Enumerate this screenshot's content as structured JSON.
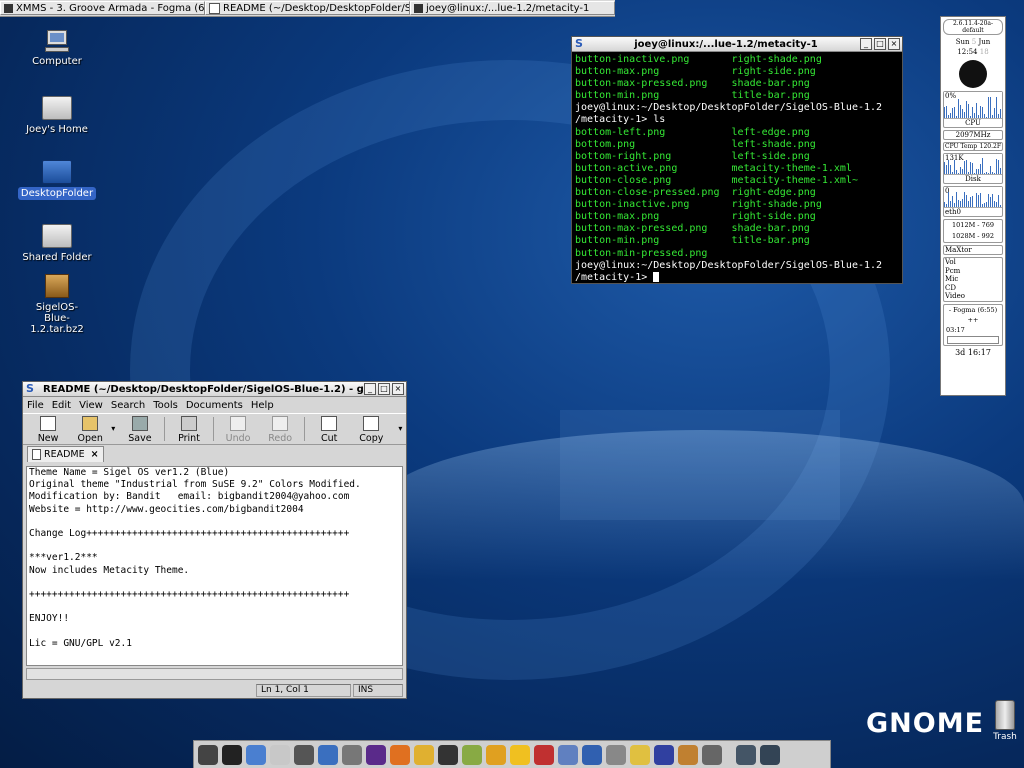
{
  "taskbar": {
    "tasks": [
      {
        "label": "XMMS - 3. Groove Armada - Fogma (6:..."
      },
      {
        "label": "README (~/Desktop/DesktopFolder/Sig..."
      },
      {
        "label": "joey@linux:/...lue-1.2/metacity-1"
      }
    ]
  },
  "desktop": {
    "icons": [
      {
        "label": "Computer",
        "icon": "computer-icon"
      },
      {
        "label": "Joey's Home",
        "icon": "home-folder-icon"
      },
      {
        "label": "DesktopFolder",
        "icon": "folder-icon"
      },
      {
        "label": "Shared Folder",
        "icon": "shared-folder-icon"
      },
      {
        "label": "SigelOS-\nBlue-1.2.tar.bz2",
        "icon": "archive-icon"
      }
    ]
  },
  "terminal": {
    "title": "joey@linux:/...lue-1.2/metacity-1",
    "lines": [
      {
        "text": "button-inactive.png       right-shade.png",
        "color": "green"
      },
      {
        "text": "button-max.png            right-side.png",
        "color": "green"
      },
      {
        "text": "button-max-pressed.png    shade-bar.png",
        "color": "green"
      },
      {
        "text": "button-min.png            title-bar.png",
        "color": "green"
      },
      {
        "text": "joey@linux:~/Desktop/DesktopFolder/SigelOS-Blue-1.2",
        "color": "white"
      },
      {
        "text": "/metacity-1> ls",
        "color": "white"
      },
      {
        "text": "bottom-left.png           left-edge.png",
        "color": "green"
      },
      {
        "text": "bottom.png                left-shade.png",
        "color": "green"
      },
      {
        "text": "bottom-right.png          left-side.png",
        "color": "green"
      },
      {
        "text": "button-active.png         metacity-theme-1.xml",
        "color": "green"
      },
      {
        "text": "button-close.png          metacity-theme-1.xml~",
        "color": "green"
      },
      {
        "text": "button-close-pressed.png  right-edge.png",
        "color": "green"
      },
      {
        "text": "button-inactive.png       right-shade.png",
        "color": "green"
      },
      {
        "text": "button-max.png            right-side.png",
        "color": "green"
      },
      {
        "text": "button-max-pressed.png    shade-bar.png",
        "color": "green"
      },
      {
        "text": "button-min.png            title-bar.png",
        "color": "green"
      },
      {
        "text": "button-min-pressed.png",
        "color": "green"
      },
      {
        "text": "joey@linux:~/Desktop/DesktopFolder/SigelOS-Blue-1.2",
        "color": "white"
      },
      {
        "text": "/metacity-1> ",
        "color": "white"
      }
    ]
  },
  "gedit": {
    "title": "README (~/Desktop/DesktopFolder/SigelOS-Blue-1.2) - gedit",
    "menu": [
      "File",
      "Edit",
      "View",
      "Search",
      "Tools",
      "Documents",
      "Help"
    ],
    "toolbar": [
      {
        "label": "New",
        "icon": "new-document-icon",
        "enabled": true
      },
      {
        "label": "Open",
        "icon": "open-folder-icon",
        "enabled": true
      },
      {
        "label": "Save",
        "icon": "save-disk-icon",
        "enabled": true
      },
      {
        "label": "Print",
        "icon": "printer-icon",
        "enabled": true
      },
      {
        "label": "Undo",
        "icon": "undo-icon",
        "enabled": false
      },
      {
        "label": "Redo",
        "icon": "redo-icon",
        "enabled": false
      },
      {
        "label": "Cut",
        "icon": "scissors-icon",
        "enabled": true
      },
      {
        "label": "Copy",
        "icon": "copy-icon",
        "enabled": true
      }
    ],
    "tab": "README",
    "content": "Theme Name = Sigel OS ver1.2 (Blue)\nOriginal theme \"Industrial from SuSE 9.2\" Colors Modified.\nModification by: Bandit   email: bigbandit2004@yahoo.com\nWebsite = http://www.geocities.com/bigbandit2004\n\nChange Log++++++++++++++++++++++++++++++++++++++++++++++\n\n***ver1.2***\nNow includes Metacity Theme.\n\n++++++++++++++++++++++++++++++++++++++++++++++++++++++++\n\nENJOY!!\n\nLic = GNU/GPL v2.1",
    "status": {
      "position": "Ln 1, Col 1",
      "mode": "INS"
    }
  },
  "gkrellm": {
    "kernel": "2.6.11.4-20a-default",
    "day": "Sun",
    "date": "5",
    "month": "Jun",
    "time": "12:54",
    "seconds": "18",
    "cpu_percent": "0%",
    "cpu_label": "CPU",
    "cpu_freq": "2097MHz",
    "temp_label": "CPU Temp",
    "temp_value": "120.2F",
    "disk_value": "131K",
    "disk_label": "Disk",
    "net_value": "0",
    "net_label": "eth0",
    "mem1": "1012M - 769",
    "mem2": "1028M - 992",
    "drive": "MaXtor",
    "mixer": [
      "Vol",
      "Pcm",
      "Mic",
      "CD",
      "Video"
    ],
    "xmms_title": "- Fogma (6:55) ++",
    "xmms_time": "03:17",
    "uptime": "3d 16:17"
  },
  "dock": {
    "items": [
      "gnome-foot-icon",
      "terminal-icon",
      "cube-icon",
      "notepad-icon",
      "calculator-icon",
      "screen-icon",
      "bird-icon",
      "nvu-icon",
      "firefox-icon",
      "gaim-icon",
      "xchat-icon",
      "gqview-icon",
      "person-icon",
      "sun-icon",
      "calendar-icon",
      "wand-icon",
      "people-icon",
      "clock-icon",
      "moon-icon",
      "wizard-icon",
      "house-icon",
      "monitor-icon",
      "desktop-icon",
      "workspace-icon"
    ]
  },
  "gnome_logo": "GNOME",
  "trash_label": "Trash"
}
